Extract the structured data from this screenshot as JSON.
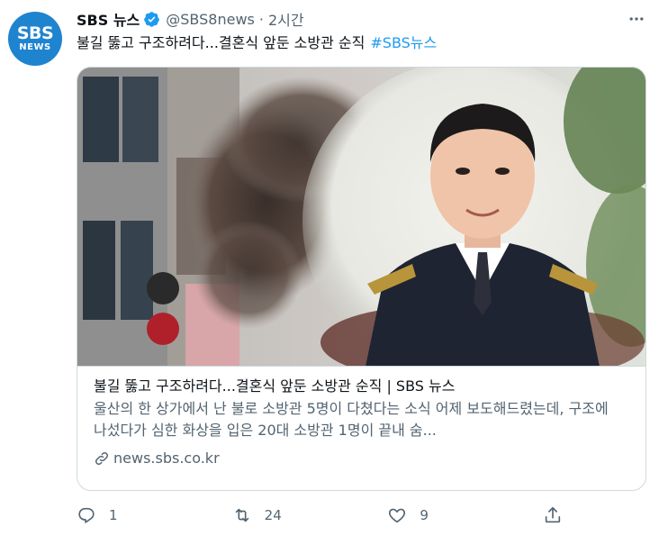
{
  "account": {
    "logo_top": "SBS",
    "logo_bottom": "NEWS",
    "display_name": "SBS 뉴스",
    "handle": "@SBS8news",
    "separator": "·",
    "time": "2시간"
  },
  "tweet": {
    "text": "불길 뚫고 구조하려다...결혼식 앞둔 소방관 순직",
    "hashtag": "#SBS뉴스"
  },
  "card": {
    "title": "불길 뚫고 구조하려다...결혼식 앞둔 소방관 순직 | SBS 뉴스",
    "description": "울산의 한 상가에서 난 불로 소방관 5명이 다쳤다는 소식 어제 보도해드렸는데, 구조에 나섰다가 심한 화상을 입은 20대 소방관 1명이 끝내 숨...",
    "domain": "news.sbs.co.kr"
  },
  "actions": {
    "reply_count": "1",
    "retweet_count": "24",
    "like_count": "9"
  },
  "colors": {
    "accent": "#1d9bf0",
    "brand": "#1f84cf",
    "secondary_text": "#536471",
    "border": "#cfd9de"
  },
  "icons": [
    "verified-badge-icon",
    "more-icon",
    "link-icon",
    "reply-icon",
    "retweet-icon",
    "like-icon",
    "share-icon"
  ]
}
